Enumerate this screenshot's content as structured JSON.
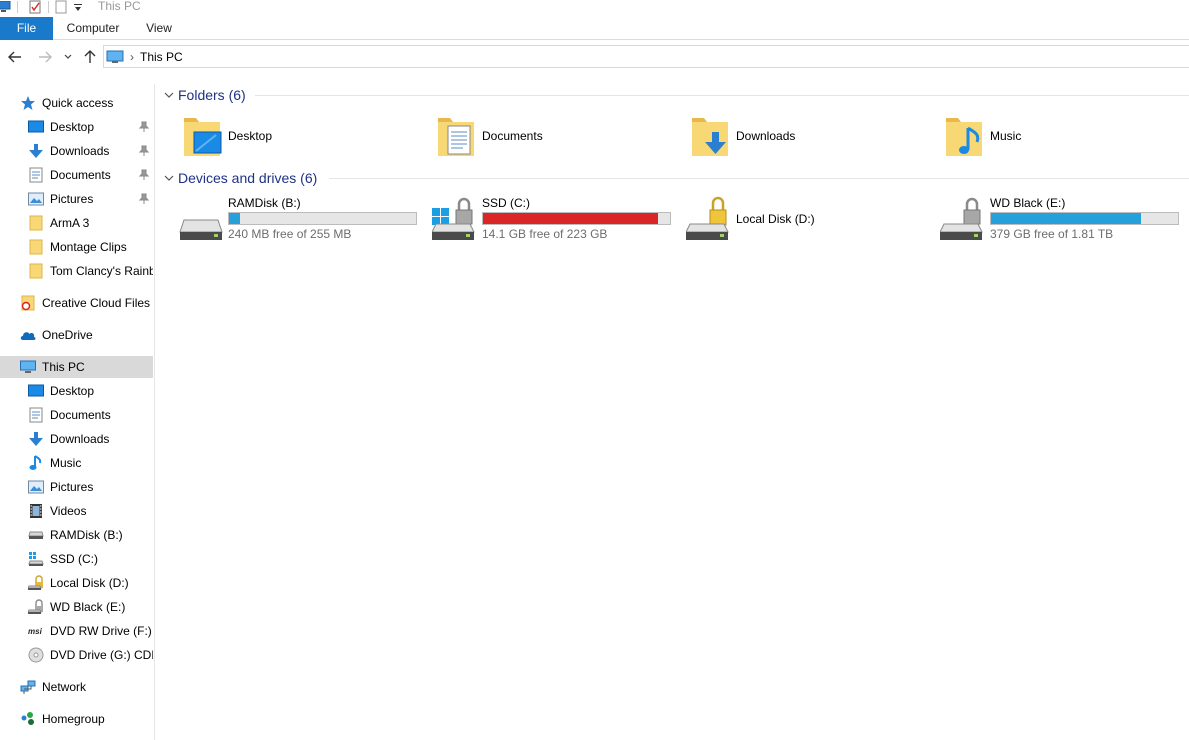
{
  "window": {
    "title": "This PC"
  },
  "ribbon": {
    "tabs": [
      "File",
      "Computer",
      "View"
    ]
  },
  "address": {
    "crumbs": [
      "This PC"
    ]
  },
  "sidebar": {
    "items": [
      {
        "label": "Quick access",
        "icon": "star-icon",
        "level": 0,
        "pinned": false
      },
      {
        "label": "Desktop",
        "icon": "desktop-icon",
        "level": 1,
        "pinned": true
      },
      {
        "label": "Downloads",
        "icon": "download-icon",
        "level": 1,
        "pinned": true
      },
      {
        "label": "Documents",
        "icon": "documents-icon",
        "level": 1,
        "pinned": true
      },
      {
        "label": "Pictures",
        "icon": "pictures-icon",
        "level": 1,
        "pinned": true
      },
      {
        "label": "ArmA 3",
        "icon": "folder-icon",
        "level": 1,
        "pinned": false
      },
      {
        "label": "Montage Clips",
        "icon": "folder-icon",
        "level": 1,
        "pinned": false
      },
      {
        "label": "Tom Clancy's Rainb",
        "icon": "folder-icon",
        "level": 1,
        "pinned": false
      },
      {
        "label": "Creative Cloud Files",
        "icon": "creative-cloud-icon",
        "level": 0,
        "pinned": false
      },
      {
        "label": "OneDrive",
        "icon": "onedrive-icon",
        "level": 0,
        "pinned": false
      },
      {
        "label": "This PC",
        "icon": "computer-icon",
        "level": 0,
        "pinned": false,
        "selected": true
      },
      {
        "label": "Desktop",
        "icon": "desktop-icon",
        "level": 1,
        "pinned": false
      },
      {
        "label": "Documents",
        "icon": "documents-icon",
        "level": 1,
        "pinned": false
      },
      {
        "label": "Downloads",
        "icon": "download-icon",
        "level": 1,
        "pinned": false
      },
      {
        "label": "Music",
        "icon": "music-icon",
        "level": 1,
        "pinned": false
      },
      {
        "label": "Pictures",
        "icon": "pictures-icon",
        "level": 1,
        "pinned": false
      },
      {
        "label": "Videos",
        "icon": "videos-icon",
        "level": 1,
        "pinned": false
      },
      {
        "label": "RAMDisk (B:)",
        "icon": "drive-icon",
        "level": 1,
        "pinned": false
      },
      {
        "label": "SSD (C:)",
        "icon": "system-drive-icon",
        "level": 1,
        "pinned": false
      },
      {
        "label": "Local Disk (D:)",
        "icon": "locked-drive-icon",
        "level": 1,
        "pinned": false
      },
      {
        "label": "WD Black (E:)",
        "icon": "locked-drive-icon",
        "level": 1,
        "pinned": false
      },
      {
        "label": "DVD RW Drive (F:) G",
        "icon": "msi-dvd-icon",
        "level": 1,
        "pinned": false
      },
      {
        "label": "DVD Drive (G:) CDR(",
        "icon": "dvd-icon",
        "level": 1,
        "pinned": false
      },
      {
        "label": "Network",
        "icon": "network-icon",
        "level": 0,
        "pinned": false
      },
      {
        "label": "Homegroup",
        "icon": "homegroup-icon",
        "level": 0,
        "pinned": false
      }
    ]
  },
  "folders": {
    "title": "Folders (6)",
    "items": [
      {
        "label": "Desktop",
        "icon": "desktop-folder-icon"
      },
      {
        "label": "Documents",
        "icon": "documents-folder-icon"
      },
      {
        "label": "Downloads",
        "icon": "downloads-folder-icon"
      },
      {
        "label": "Music",
        "icon": "music-folder-icon"
      }
    ]
  },
  "drives": {
    "title": "Devices and drives (6)",
    "items": [
      {
        "label": "RAMDisk (B:)",
        "free": "240 MB free of 255 MB",
        "used_fraction": 0.06,
        "color": "#26a0da",
        "icon": "drive-icon"
      },
      {
        "label": "SSD (C:)",
        "free": "14.1 GB free of 223 GB",
        "used_fraction": 0.937,
        "color": "#da2626",
        "icon": "system-drive-icon"
      },
      {
        "label": "Local Disk (D:)",
        "free": "",
        "icon": "locked-drive-icon"
      },
      {
        "label": "WD Black (E:)",
        "free": "379 GB free of 1.81 TB",
        "used_fraction": 0.8,
        "color": "#26a0da",
        "icon": "locked-drive-icon"
      }
    ]
  }
}
